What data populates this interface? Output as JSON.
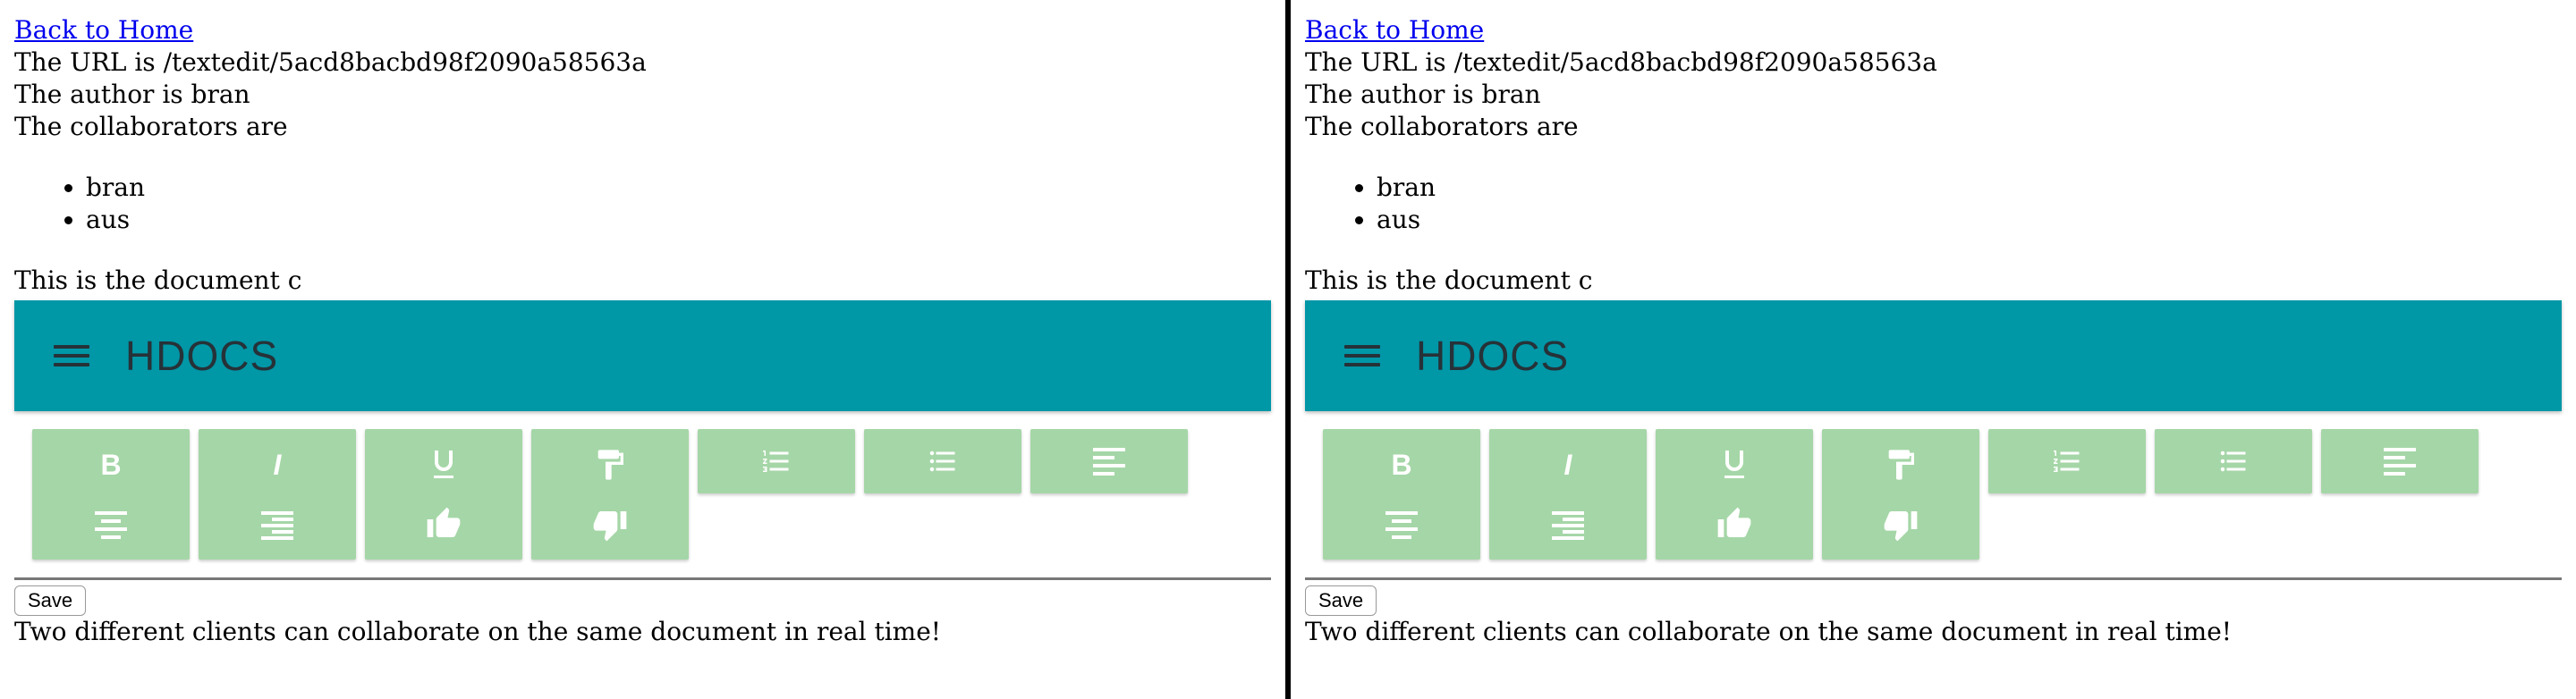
{
  "panes": [
    {
      "back_link": "Back to Home",
      "url_text": "The URL is /textedit/5acd8bacbd98f2090a58563a",
      "author_text": "The author is bran",
      "collaborators_text": "The collaborators are",
      "collaborators": [
        "bran",
        "aus"
      ],
      "document_text": "This is the document c",
      "app_title": "HDOCS",
      "save_label": "Save",
      "footer_text": "Two different clients can collaborate on the same document in real time!"
    },
    {
      "back_link": "Back to Home",
      "url_text": "The URL is /textedit/5acd8bacbd98f2090a58563a",
      "author_text": "The author is bran",
      "collaborators_text": "The collaborators are",
      "collaborators": [
        "bran",
        "aus"
      ],
      "document_text": "This is the document c",
      "app_title": "HDOCS",
      "save_label": "Save",
      "footer_text": "Two different clients can collaborate on the same document in real time!"
    }
  ],
  "toolbar_icons": [
    "bold-icon",
    "italic-icon",
    "underline-icon",
    "paint-roller-icon",
    "numbered-list-icon",
    "bulleted-list-icon",
    "align-left-icon",
    "align-center-icon",
    "align-right-icon",
    "thumbs-up-icon",
    "thumbs-down-icon"
  ],
  "colors": {
    "appbar": "#0097a7",
    "toolbar_button": "#a5d6a7",
    "icon": "#ffffff",
    "divider": "#000000"
  }
}
